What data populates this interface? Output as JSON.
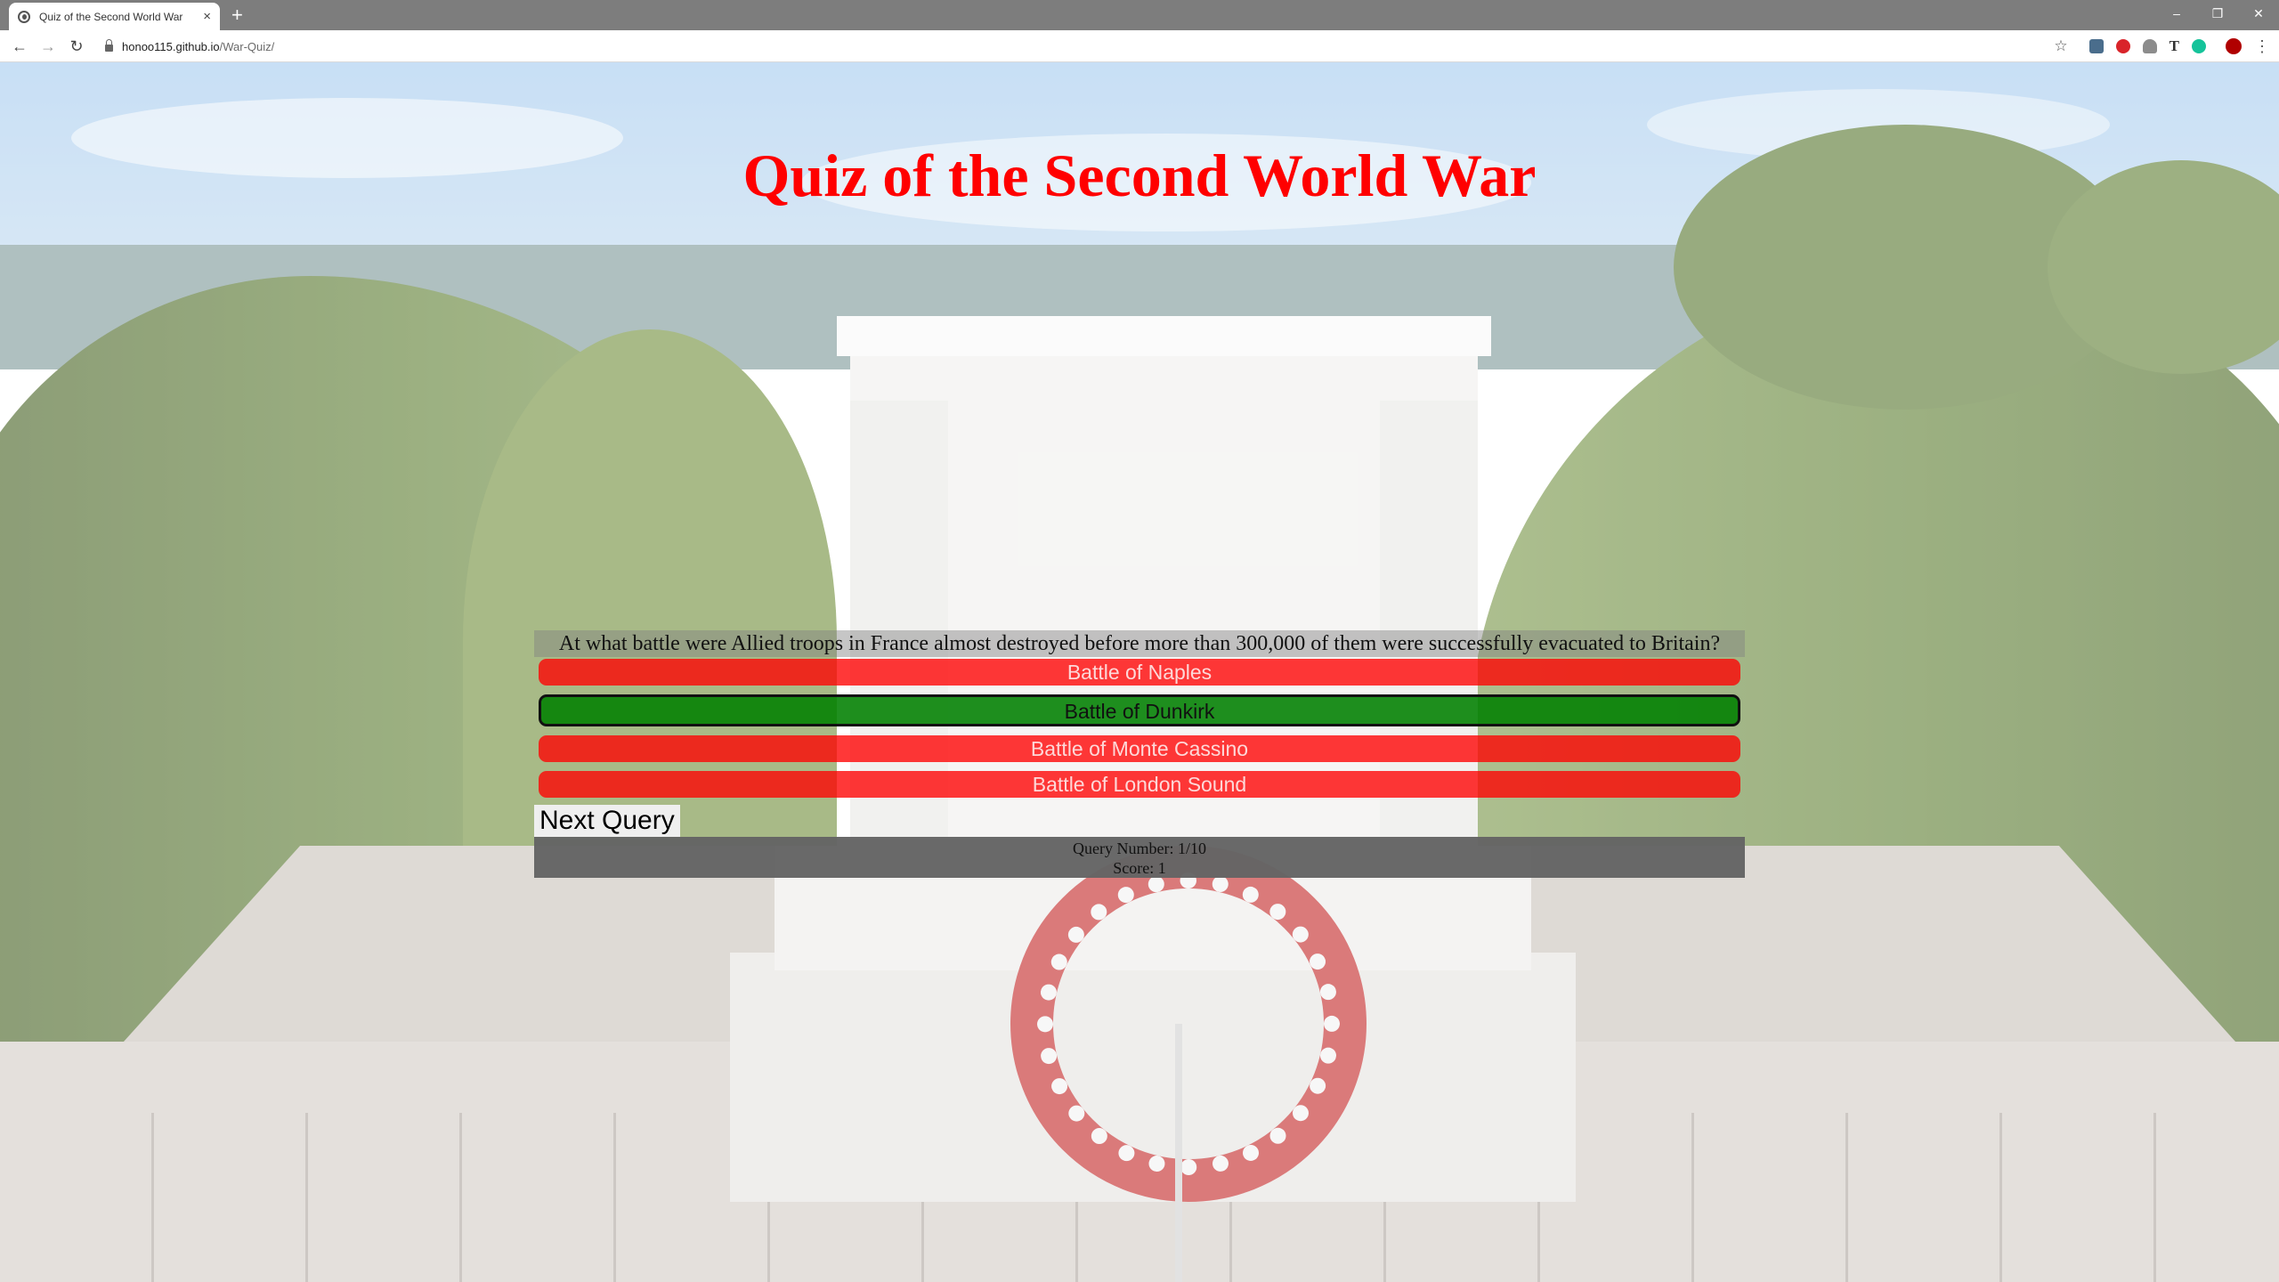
{
  "browser": {
    "tab_title": "Quiz of the Second World War",
    "tab_close": "×",
    "new_tab": "+",
    "url_host": "honoo115.github.io",
    "url_path": "/War-Quiz/",
    "nav": {
      "back": "←",
      "forward": "→",
      "reload": "↻"
    },
    "bookmark": "☆",
    "ext_type_glyph": "T",
    "menu": "⋮",
    "window": {
      "minimize": "–",
      "restore": "❐",
      "close": "✕"
    }
  },
  "page": {
    "title": "Quiz of the Second World War",
    "title_color": "#ff0000"
  },
  "quiz": {
    "question": "At what battle were Allied troops in France almost destroyed before more than 300,000 of them were successfully evacuated to Britain?",
    "answers": [
      {
        "label": "Battle of Naples",
        "state": "wrong",
        "color": "#ff0000"
      },
      {
        "label": "Battle of Dunkirk",
        "state": "correct",
        "color": "#008000"
      },
      {
        "label": "Battle of Monte Cassino",
        "state": "wrong",
        "color": "#ff0000"
      },
      {
        "label": "Battle of London Sound",
        "state": "wrong",
        "color": "#ff0000"
      }
    ],
    "next_label": "Next Query",
    "query_number": "Query Number: 1/10",
    "score": "Score: 1"
  },
  "icons": {
    "favicon": "globe-icon",
    "lock": "lock-icon",
    "profile": "avatar"
  }
}
